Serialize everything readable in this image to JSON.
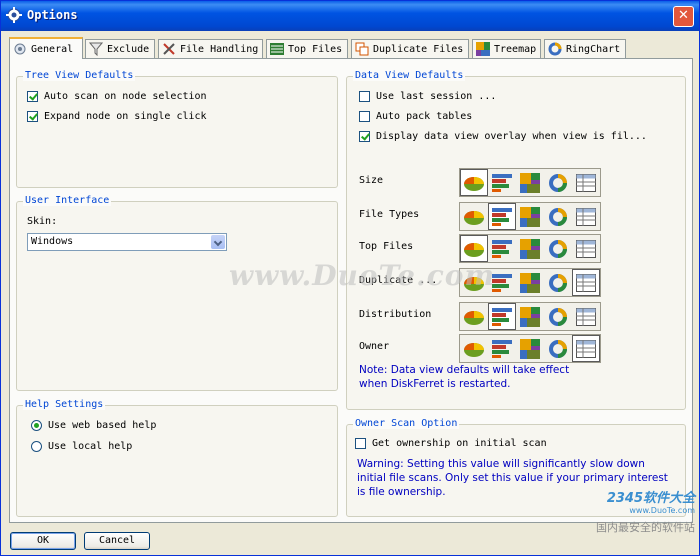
{
  "window": {
    "title": "Options",
    "close_glyph": "✕"
  },
  "tabs": [
    {
      "label": "General",
      "icon": "gear-icon",
      "active": true
    },
    {
      "label": "Exclude",
      "icon": "filter-icon"
    },
    {
      "label": "File Handling",
      "icon": "cross-tools-icon"
    },
    {
      "label": "Top Files",
      "icon": "list-icon"
    },
    {
      "label": "Duplicate Files",
      "icon": "duplicate-icon"
    },
    {
      "label": "Treemap",
      "icon": "treemap-icon"
    },
    {
      "label": "RingChart",
      "icon": "ringchart-icon"
    }
  ],
  "tree_view": {
    "legend": "Tree View Defaults",
    "options": [
      {
        "label": "Auto scan on node selection",
        "checked": true
      },
      {
        "label": "Expand node on single click",
        "checked": true
      }
    ]
  },
  "user_interface": {
    "legend": "User Interface",
    "skin_label": "Skin:",
    "skin_value": "Windows"
  },
  "help_settings": {
    "legend": "Help Settings",
    "options": [
      {
        "label": "Use web based help",
        "selected": true
      },
      {
        "label": "Use local help",
        "selected": false
      }
    ]
  },
  "data_view": {
    "legend": "Data View Defaults",
    "options": [
      {
        "label": "Use last session ...",
        "checked": false
      },
      {
        "label": "Auto pack tables",
        "checked": false
      },
      {
        "label": "Display data view overlay when view is fil...",
        "checked": true
      }
    ],
    "icon_names": [
      "piechart-icon",
      "barchart-icon",
      "treemap-icon",
      "ringchart-icon",
      "table-icon"
    ],
    "rows": [
      {
        "label": "Size",
        "selected_view": "piechart"
      },
      {
        "label": "File Types",
        "selected_view": "barchart"
      },
      {
        "label": "Top Files",
        "selected_view": "piechart"
      },
      {
        "label": "Duplicate ...",
        "selected_view": "table"
      },
      {
        "label": "Distribution",
        "selected_view": "barchart"
      },
      {
        "label": "Owner",
        "selected_view": "table"
      }
    ],
    "note": "Note: Data view defaults will take effect when DiskFerret is restarted."
  },
  "owner_scan": {
    "legend": "Owner Scan Option",
    "option": {
      "label": "Get ownership on initial scan",
      "checked": false
    },
    "warning": "Warning: Setting this value will significantly slow down initial file scans.  Only set this value if your primary interest is file ownership."
  },
  "buttons": {
    "ok": "OK",
    "cancel": "Cancel"
  },
  "watermark": "www.DuoTe.com",
  "brand": {
    "logo": "2345软件大全",
    "url": "www.DuoTe.com",
    "slogan": "国内最安全的软件站"
  }
}
